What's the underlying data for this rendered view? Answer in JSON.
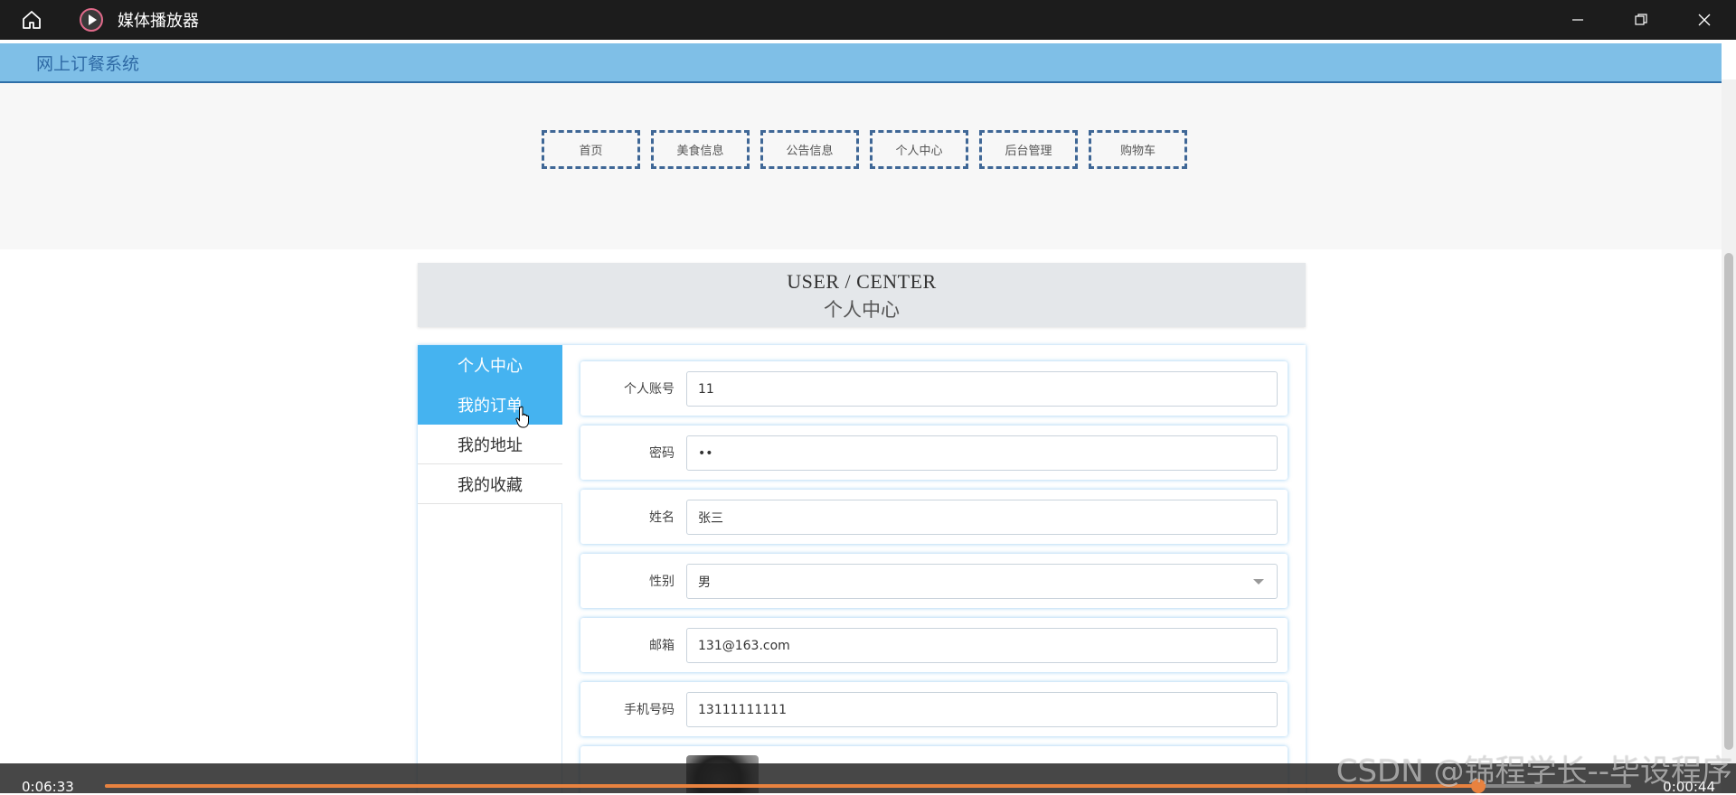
{
  "window": {
    "title": "媒体播放器",
    "icons": {
      "home": "home-icon",
      "app": "play-circle-icon",
      "minimize": "minimize-icon",
      "restore": "restore-icon",
      "close": "close-icon"
    }
  },
  "site": {
    "name": "网上订餐系统",
    "nav": [
      "首页",
      "美食信息",
      "公告信息",
      "个人中心",
      "后台管理",
      "购物车"
    ]
  },
  "banner": {
    "en": "USER / CENTER",
    "cn": "个人中心"
  },
  "sidebar": {
    "items": [
      {
        "label": "个人中心",
        "active": true
      },
      {
        "label": "我的订单",
        "active": true
      },
      {
        "label": "我的地址",
        "active": false
      },
      {
        "label": "我的收藏",
        "active": false
      }
    ]
  },
  "form": {
    "account": {
      "label": "个人账号",
      "value": "11"
    },
    "password": {
      "label": "密码",
      "value": "••"
    },
    "name": {
      "label": "姓名",
      "value": "张三"
    },
    "gender": {
      "label": "性别",
      "value": "男"
    },
    "email": {
      "label": "邮箱",
      "value": "131@163.com"
    },
    "phone": {
      "label": "手机号码",
      "value": "13111111111"
    }
  },
  "player": {
    "elapsed": "0:06:33",
    "remaining": "0:00:44",
    "progress_fraction": 0.9,
    "accent_color": "#e8823f"
  },
  "watermark": "CSDN @锦程学长--毕设程序",
  "colors": {
    "header": "#7fbfe7",
    "active_menu": "#45b3f0",
    "nav_border": "#3f6796"
  }
}
